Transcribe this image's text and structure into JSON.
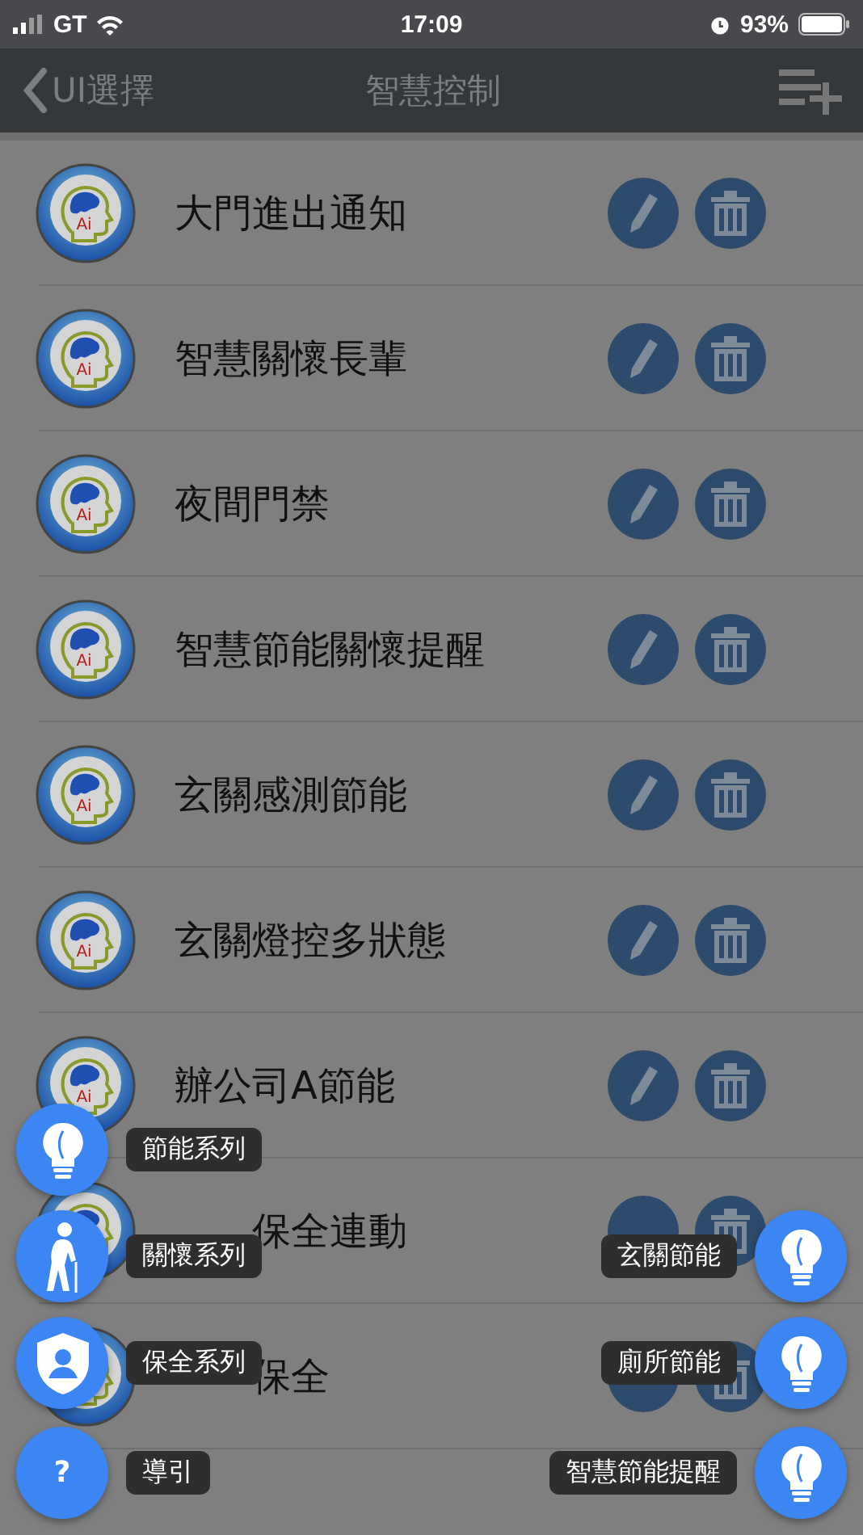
{
  "status_bar": {
    "carrier": "GT",
    "time": "17:09",
    "battery": "93%"
  },
  "nav": {
    "back": "UI選擇",
    "title": "智慧控制"
  },
  "rules": [
    {
      "logo": "Ai",
      "title": "大門進出通知",
      "covered": false
    },
    {
      "logo": "Ai",
      "title": "智慧關懷長輩",
      "covered": false
    },
    {
      "logo": "Ai",
      "title": "夜間門禁",
      "covered": false
    },
    {
      "logo": "Ai",
      "title": "智慧節能關懷提醒",
      "covered": false
    },
    {
      "logo": "Ai",
      "title": "玄關感測節能",
      "covered": false
    },
    {
      "logo": "Ai",
      "title": "玄關燈控多狀態",
      "covered": false
    },
    {
      "logo": "Ai",
      "title": "辦公司A節能",
      "covered": false
    },
    {
      "title": "保全連動",
      "covered": true
    },
    {
      "title": "保全",
      "covered": true
    }
  ],
  "fab_left": [
    {
      "kind": "bulb",
      "label": "節能系列"
    },
    {
      "kind": "elder",
      "label": "關懷系列"
    },
    {
      "kind": "shield",
      "label": "保全系列"
    },
    {
      "kind": "question",
      "symbol": "?",
      "label": "導引"
    }
  ],
  "fab_right": [
    {
      "kind": "bulb",
      "label": "玄關節能"
    },
    {
      "kind": "bulb",
      "label": "廁所節能"
    },
    {
      "kind": "bulb",
      "label": "智慧節能提醒"
    }
  ]
}
